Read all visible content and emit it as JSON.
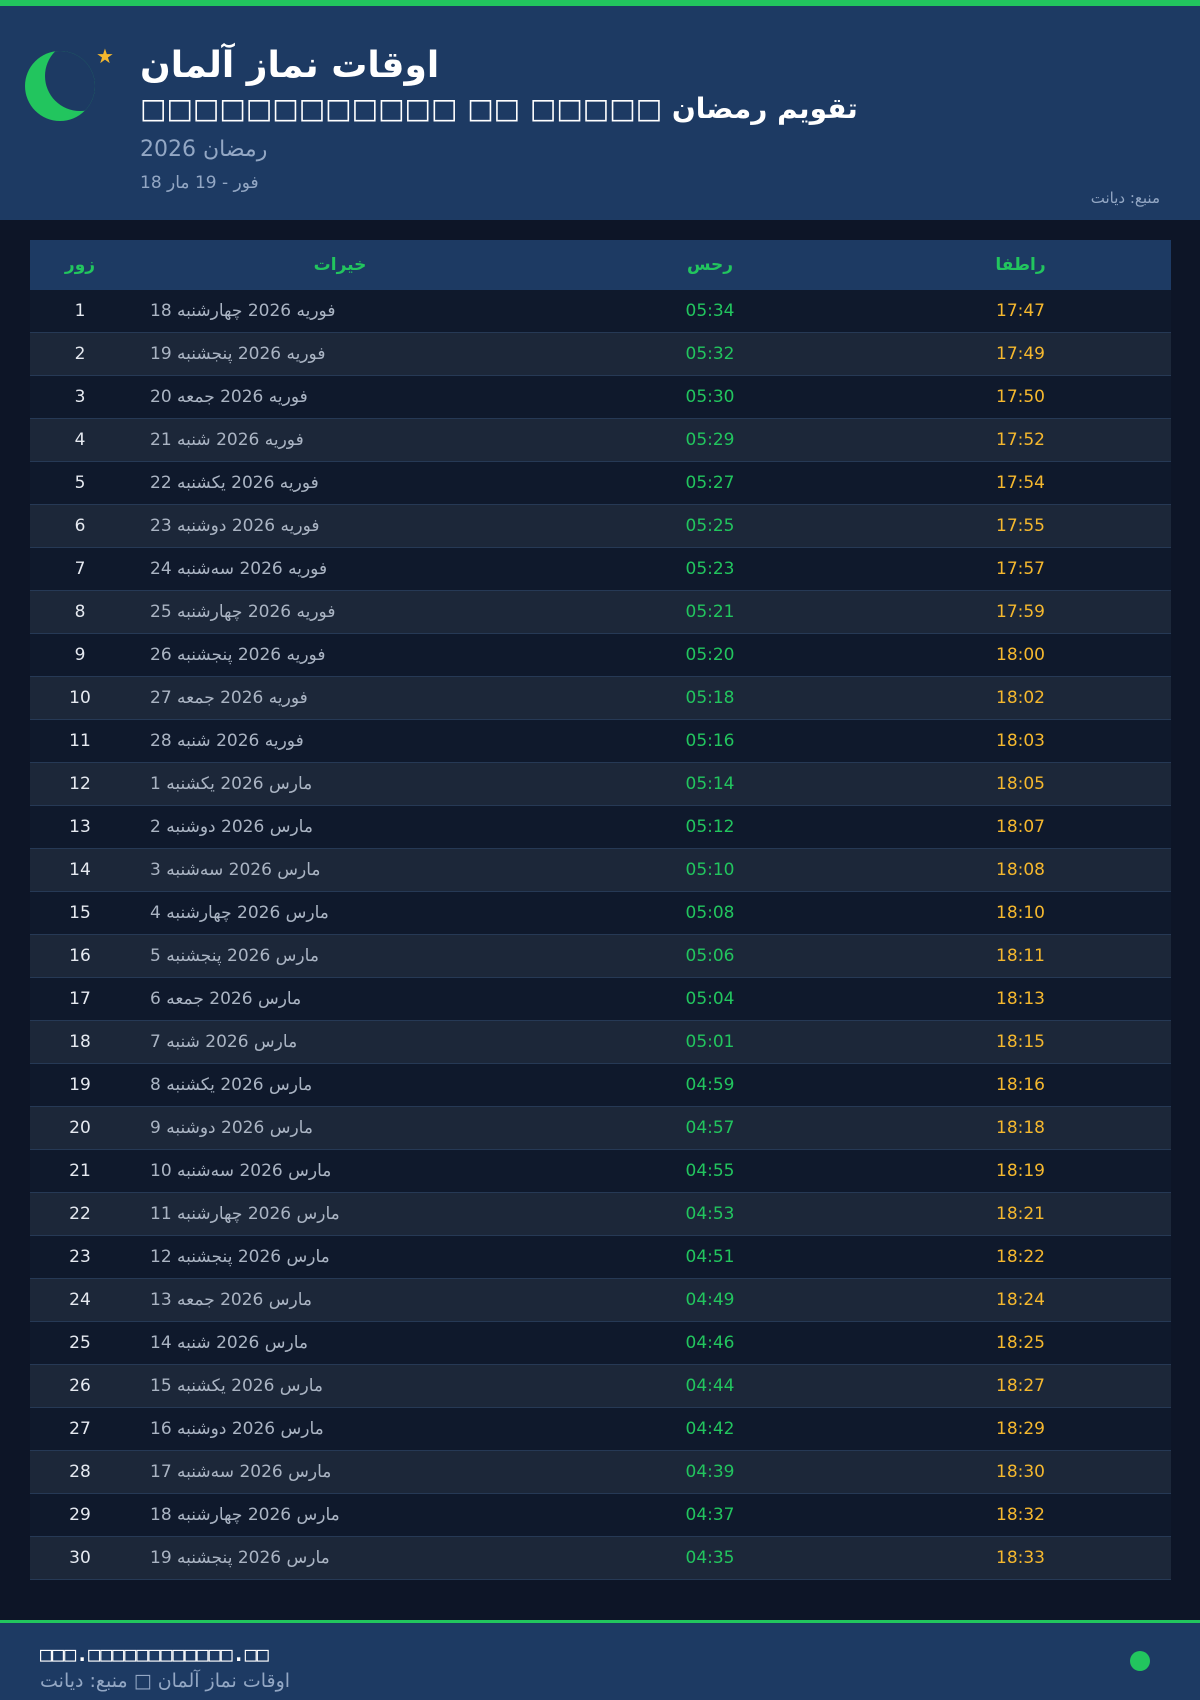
{
  "header": {
    "title": "اوقات نماز آلمان",
    "subtitle": "□□□□□□□□□□□□ □□ □□□□□ تقویم رمضان",
    "year_label": "رمضان 2026",
    "range_label": "18 فور - 19 مار",
    "source_label": "منبع: دیانت"
  },
  "colors": {
    "accent": "#22c55e",
    "header_bg": "#1d3a63",
    "page_bg": "#0d1527",
    "iftar": "#f5b82e"
  },
  "icons": [
    "crescent-moon-icon",
    "star-icon"
  ],
  "table": {
    "headers": {
      "day": "زور",
      "date": "خیرات",
      "fajr": "رحس",
      "iftar": "راطفا"
    },
    "rows": [
      {
        "day": "1",
        "date": "18 فوریه 2026 چهارشنبه",
        "fajr": "05:34",
        "iftar": "17:47"
      },
      {
        "day": "2",
        "date": "19 فوریه 2026 پنجشنبه",
        "fajr": "05:32",
        "iftar": "17:49"
      },
      {
        "day": "3",
        "date": "20 فوریه 2026 جمعه",
        "fajr": "05:30",
        "iftar": "17:50"
      },
      {
        "day": "4",
        "date": "21 فوریه 2026 شنبه",
        "fajr": "05:29",
        "iftar": "17:52"
      },
      {
        "day": "5",
        "date": "22 فوریه 2026 یکشنبه",
        "fajr": "05:27",
        "iftar": "17:54"
      },
      {
        "day": "6",
        "date": "23 فوریه 2026 دوشنبه",
        "fajr": "05:25",
        "iftar": "17:55"
      },
      {
        "day": "7",
        "date": "24 فوریه 2026 سه‌شنبه",
        "fajr": "05:23",
        "iftar": "17:57"
      },
      {
        "day": "8",
        "date": "25 فوریه 2026 چهارشنبه",
        "fajr": "05:21",
        "iftar": "17:59"
      },
      {
        "day": "9",
        "date": "26 فوریه 2026 پنجشنبه",
        "fajr": "05:20",
        "iftar": "18:00"
      },
      {
        "day": "10",
        "date": "27 فوریه 2026 جمعه",
        "fajr": "05:18",
        "iftar": "18:02"
      },
      {
        "day": "11",
        "date": "28 فوریه 2026 شنبه",
        "fajr": "05:16",
        "iftar": "18:03"
      },
      {
        "day": "12",
        "date": "1 مارس 2026 یکشنبه",
        "fajr": "05:14",
        "iftar": "18:05"
      },
      {
        "day": "13",
        "date": "2 مارس 2026 دوشنبه",
        "fajr": "05:12",
        "iftar": "18:07"
      },
      {
        "day": "14",
        "date": "3 مارس 2026 سه‌شنبه",
        "fajr": "05:10",
        "iftar": "18:08"
      },
      {
        "day": "15",
        "date": "4 مارس 2026 چهارشنبه",
        "fajr": "05:08",
        "iftar": "18:10"
      },
      {
        "day": "16",
        "date": "5 مارس 2026 پنجشنبه",
        "fajr": "05:06",
        "iftar": "18:11"
      },
      {
        "day": "17",
        "date": "6 مارس 2026 جمعه",
        "fajr": "05:04",
        "iftar": "18:13"
      },
      {
        "day": "18",
        "date": "7 مارس 2026 شنبه",
        "fajr": "05:01",
        "iftar": "18:15"
      },
      {
        "day": "19",
        "date": "8 مارس 2026 یکشنبه",
        "fajr": "04:59",
        "iftar": "18:16"
      },
      {
        "day": "20",
        "date": "9 مارس 2026 دوشنبه",
        "fajr": "04:57",
        "iftar": "18:18"
      },
      {
        "day": "21",
        "date": "10 مارس 2026 سه‌شنبه",
        "fajr": "04:55",
        "iftar": "18:19"
      },
      {
        "day": "22",
        "date": "11 مارس 2026 چهارشنبه",
        "fajr": "04:53",
        "iftar": "18:21"
      },
      {
        "day": "23",
        "date": "12 مارس 2026 پنجشنبه",
        "fajr": "04:51",
        "iftar": "18:22"
      },
      {
        "day": "24",
        "date": "13 مارس 2026 جمعه",
        "fajr": "04:49",
        "iftar": "18:24"
      },
      {
        "day": "25",
        "date": "14 مارس 2026 شنبه",
        "fajr": "04:46",
        "iftar": "18:25"
      },
      {
        "day": "26",
        "date": "15 مارس 2026 یکشنبه",
        "fajr": "04:44",
        "iftar": "18:27"
      },
      {
        "day": "27",
        "date": "16 مارس 2026 دوشنبه",
        "fajr": "04:42",
        "iftar": "18:29"
      },
      {
        "day": "28",
        "date": "17 مارس 2026 سه‌شنبه",
        "fajr": "04:39",
        "iftar": "18:30"
      },
      {
        "day": "29",
        "date": "18 مارس 2026 چهارشنبه",
        "fajr": "04:37",
        "iftar": "18:32"
      },
      {
        "day": "30",
        "date": "19 مارس 2026 پنجشنبه",
        "fajr": "04:35",
        "iftar": "18:33"
      }
    ]
  },
  "footer": {
    "url": "□□□.□□□□□□□□□□□□.□□",
    "brand": "اوقات نماز آلمان □ منبع: دیانت"
  }
}
